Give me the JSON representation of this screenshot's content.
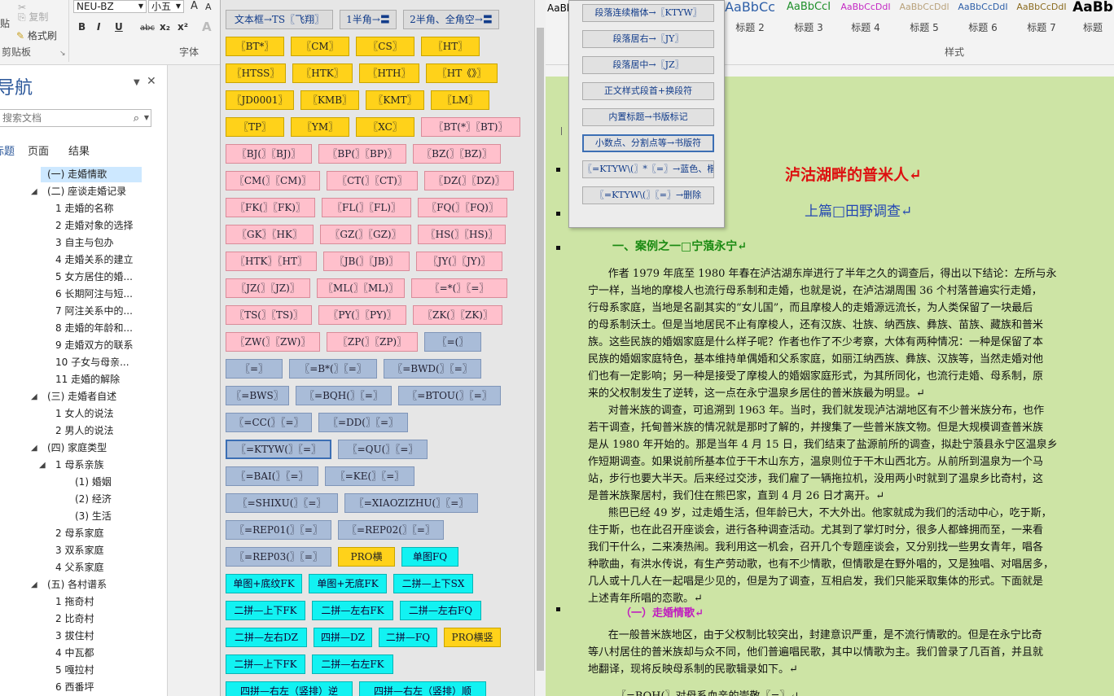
{
  "ribbon": {
    "clipboard": {
      "paste": "贴",
      "copy": "复制",
      "format_painter": "格式刷",
      "label": "剪贴板"
    },
    "font": {
      "name": "NEU-BZ",
      "size": "小五",
      "label": "字体",
      "grow": "A",
      "shrink": "A"
    },
    "font_buttons": [
      "B",
      "I",
      "U",
      "abc",
      "x₂",
      "x²",
      "A"
    ],
    "styles": [
      {
        "sample": "AaBb",
        "name": "",
        "color": "#000000",
        "size": "12px"
      },
      {
        "sample": "AaBbCc",
        "name": "标题 2",
        "color": "#2e5fa8",
        "size": "16px"
      },
      {
        "sample": "AaBbCcI",
        "name": "标题 3",
        "color": "#1f8f2a",
        "size": "13px"
      },
      {
        "sample": "AaBbCcDdI",
        "name": "标题 4",
        "color": "#c42ac4",
        "size": "12px"
      },
      {
        "sample": "AaBbCcDdl",
        "name": "标题 5",
        "color": "#b8a17a",
        "size": "12px"
      },
      {
        "sample": "AaBbCcDdI",
        "name": "标题 6",
        "color": "#2e5fa8",
        "size": "12px"
      },
      {
        "sample": "AaBbCcDdI",
        "name": "标题 7",
        "color": "#8b6b1f",
        "size": "12px"
      },
      {
        "sample": "AaBb",
        "name": "标题",
        "color": "#000000",
        "size": "17px"
      }
    ],
    "styles_label": "样式"
  },
  "nav": {
    "title": "导航",
    "search_placeholder": "搜索文档",
    "tabs": [
      "标题",
      "页面",
      "结果"
    ],
    "items": [
      {
        "text": "(一)  走婚情歌",
        "indent": 58,
        "arrow": "",
        "selected": true
      },
      {
        "text": "(二)  座谈走婚记录",
        "indent": 58,
        "arrow": "◢",
        "selected": false
      },
      {
        "text": "1    走婚的名称",
        "indent": 68,
        "arrow": "",
        "selected": false
      },
      {
        "text": "2    走婚对象的选择",
        "indent": 68,
        "arrow": "",
        "selected": false
      },
      {
        "text": "3    自主与包办",
        "indent": 68,
        "arrow": "",
        "selected": false
      },
      {
        "text": "4    走婚关系的建立",
        "indent": 68,
        "arrow": "",
        "selected": false
      },
      {
        "text": "5    女方居住的婚...",
        "indent": 68,
        "arrow": "",
        "selected": false
      },
      {
        "text": "6    长期阿注与短...",
        "indent": 68,
        "arrow": "",
        "selected": false
      },
      {
        "text": "7    阿注关系中的...",
        "indent": 68,
        "arrow": "",
        "selected": false
      },
      {
        "text": "8    走婚的年龄和...",
        "indent": 68,
        "arrow": "",
        "selected": false
      },
      {
        "text": "9    走婚双方的联系",
        "indent": 68,
        "arrow": "",
        "selected": false
      },
      {
        "text": "10   子女与母亲...",
        "indent": 68,
        "arrow": "",
        "selected": false
      },
      {
        "text": "11   走婚的解除",
        "indent": 68,
        "arrow": "",
        "selected": false
      },
      {
        "text": "(三)  走婚者自述",
        "indent": 58,
        "arrow": "◢",
        "selected": false
      },
      {
        "text": "1    女人的说法",
        "indent": 68,
        "arrow": "",
        "selected": false
      },
      {
        "text": "2    男人的说法",
        "indent": 68,
        "arrow": "",
        "selected": false
      },
      {
        "text": "(四)  家庭类型",
        "indent": 58,
        "arrow": "◢",
        "selected": false
      },
      {
        "text": "1    母系亲族",
        "indent": 68,
        "arrow": "◢",
        "selected": false
      },
      {
        "text": "(1)  婚姻",
        "indent": 92,
        "arrow": "",
        "selected": false
      },
      {
        "text": "(2)  经济",
        "indent": 92,
        "arrow": "",
        "selected": false
      },
      {
        "text": "(3)  生活",
        "indent": 92,
        "arrow": "",
        "selected": false
      },
      {
        "text": "2    母系家庭",
        "indent": 68,
        "arrow": "",
        "selected": false
      },
      {
        "text": "3    双系家庭",
        "indent": 68,
        "arrow": "",
        "selected": false
      },
      {
        "text": "4    父系家庭",
        "indent": 68,
        "arrow": "",
        "selected": false
      },
      {
        "text": "(五)  各村谱系",
        "indent": 58,
        "arrow": "◢",
        "selected": false
      },
      {
        "text": "1    拖奇村",
        "indent": 68,
        "arrow": "",
        "selected": false
      },
      {
        "text": "2    比奇村",
        "indent": 68,
        "arrow": "",
        "selected": false
      },
      {
        "text": "3    拔住村",
        "indent": 68,
        "arrow": "",
        "selected": false
      },
      {
        "text": "4    中瓦都",
        "indent": 68,
        "arrow": "",
        "selected": false
      },
      {
        "text": "5    嘎拉村",
        "indent": 68,
        "arrow": "",
        "selected": false
      },
      {
        "text": "6    西番坪",
        "indent": 68,
        "arrow": "",
        "selected": false
      }
    ]
  },
  "panel": {
    "rows": [
      [
        {
          "label": "文本框→TS〖飞翔〗",
          "color": "gray",
          "w": 132
        },
        {
          "label": "1半角→〓",
          "color": "gray",
          "w": 70
        },
        {
          "label": "2半角、全角空→〓",
          "color": "gray",
          "w": 118
        }
      ],
      [
        {
          "label": "〖BT*〗",
          "color": "yellow",
          "w": 72
        },
        {
          "label": "〖CM〗",
          "color": "yellow",
          "w": 72
        },
        {
          "label": "〖CS〗",
          "color": "yellow",
          "w": 72
        },
        {
          "label": "〖HT〗",
          "color": "yellow",
          "w": 72
        }
      ],
      [
        {
          "label": "〖HTSS〗",
          "color": "yellow",
          "w": 74
        },
        {
          "label": "〖HTK〗",
          "color": "yellow",
          "w": 74
        },
        {
          "label": "〖HTH〗",
          "color": "yellow",
          "w": 74
        },
        {
          "label": "〖HT《》〗",
          "color": "yellow",
          "w": 88
        }
      ],
      [
        {
          "label": "〖JD0001〗",
          "color": "yellow",
          "w": 84
        },
        {
          "label": "〖KMB〗",
          "color": "yellow",
          "w": 72
        },
        {
          "label": "〖KMT〗",
          "color": "yellow",
          "w": 72
        },
        {
          "label": "〖LM〗",
          "color": "yellow",
          "w": 72
        }
      ],
      [
        {
          "label": "〖TP〗",
          "color": "yellow",
          "w": 72
        },
        {
          "label": "〖YM〗",
          "color": "yellow",
          "w": 72
        },
        {
          "label": "〖XC〗",
          "color": "yellow",
          "w": 72
        },
        {
          "label": "〖BT(*〗〖BT)〗",
          "color": "pink",
          "w": 122
        }
      ],
      [
        {
          "label": "〖BJ(〗〖BJ)〗",
          "color": "pink",
          "w": 106
        },
        {
          "label": "〖BP(〗〖BP)〗",
          "color": "pink",
          "w": 108
        },
        {
          "label": "〖BZ(〗〖BZ)〗",
          "color": "pink",
          "w": 108
        }
      ],
      [
        {
          "label": "〖CM(〗〖CM)〗",
          "color": "pink",
          "w": 116
        },
        {
          "label": "〖CT(〗〖CT)〗",
          "color": "pink",
          "w": 112
        },
        {
          "label": "〖DZ(〗〖DZ)〗",
          "color": "pink",
          "w": 110
        }
      ],
      [
        {
          "label": "〖FK(〗〖FK)〗",
          "color": "pink",
          "w": 110
        },
        {
          "label": "〖FL(〗〖FL)〗",
          "color": "pink",
          "w": 110
        },
        {
          "label": "〖FQ(〗〖FQ)〗",
          "color": "pink",
          "w": 110
        }
      ],
      [
        {
          "label": "〖GK〗〖HK〗",
          "color": "pink",
          "w": 108
        },
        {
          "label": "〖GZ(〗〖GZ)〗",
          "color": "pink",
          "w": 112
        },
        {
          "label": "〖HS(〗〖HS)〗",
          "color": "pink",
          "w": 108
        }
      ],
      [
        {
          "label": "〖HTK〗〖HT〗",
          "color": "pink",
          "w": 112
        },
        {
          "label": "〖JB(〗〖JB)〗",
          "color": "pink",
          "w": 106
        },
        {
          "label": "〖JY(〗〖JY)〗",
          "color": "pink",
          "w": 106
        }
      ],
      [
        {
          "label": "〖JZ(〗〖JZ)〗",
          "color": "pink",
          "w": 104
        },
        {
          "label": "〖ML(〗〖ML)〗",
          "color": "pink",
          "w": 108
        },
        {
          "label": "〖=*(〗〖=〗",
          "color": "pink",
          "w": 118
        }
      ],
      [
        {
          "label": "〖TS(〗〖TS)〗",
          "color": "pink",
          "w": 106
        },
        {
          "label": "〖PY(〗〖PY)〗",
          "color": "pink",
          "w": 108
        },
        {
          "label": "〖ZK(〗〖ZK)〗",
          "color": "pink",
          "w": 110
        }
      ],
      [
        {
          "label": "〖ZW(〗〖ZW)〗",
          "color": "pink",
          "w": 116
        },
        {
          "label": "〖ZP(〗〖ZP)〗",
          "color": "pink",
          "w": 112
        },
        {
          "label": "〖=(〗",
          "color": "blue",
          "w": 70
        }
      ],
      [
        {
          "label": "〖=〗",
          "color": "blue",
          "w": 70
        },
        {
          "label": "〖=B*(〗〖=〗",
          "color": "blue",
          "w": 108
        },
        {
          "label": "〖=BWD(〗〖=〗",
          "color": "blue",
          "w": 120
        }
      ],
      [
        {
          "label": "〖=BWS〗",
          "color": "blue",
          "w": 78
        },
        {
          "label": "〖=BQH(〗〖=〗",
          "color": "blue",
          "w": 118
        },
        {
          "label": "〖=BTOU(〗〖=〗",
          "color": "blue",
          "w": 126
        }
      ],
      [
        {
          "label": "〖=CC(〗〖=〗",
          "color": "blue",
          "w": 106
        },
        {
          "label": "〖=DD(〗〖=〗",
          "color": "blue",
          "w": 110
        }
      ],
      [
        {
          "label": "〖=KTYW(〗〖=〗",
          "color": "blue",
          "w": 130,
          "focus": true
        },
        {
          "label": "〖=QU(〗〖=〗",
          "color": "blue",
          "w": 110
        }
      ],
      [
        {
          "label": "〖=BAI(〗〖=〗",
          "color": "blue",
          "w": 114
        },
        {
          "label": "〖=KE(〗〖=〗",
          "color": "blue",
          "w": 110
        }
      ],
      [
        {
          "label": "〖=SHIXU(〗〖=〗",
          "color": "blue",
          "w": 138
        },
        {
          "label": "〖=XIAOZIZHU(〗〖=〗",
          "color": "blue",
          "w": 164
        }
      ],
      [
        {
          "label": "〖=REP01(〗〖=〗",
          "color": "blue",
          "w": 130
        },
        {
          "label": "〖=REP02(〗〖=〗",
          "color": "blue",
          "w": 130
        }
      ],
      [
        {
          "label": "〖=REP03(〗〖=〗",
          "color": "blue",
          "w": 130
        },
        {
          "label": "PRO横",
          "color": "yellow",
          "w": 70
        },
        {
          "label": "单图FQ",
          "color": "cyan",
          "w": 70
        }
      ],
      [
        {
          "label": "单图+底纹FK",
          "color": "cyan",
          "w": 94
        },
        {
          "label": "单图+无底FK",
          "color": "cyan",
          "w": 96
        },
        {
          "label": "二拼—上下SX",
          "color": "cyan",
          "w": 98
        }
      ],
      [
        {
          "label": "二拼—上下FK",
          "color": "cyan",
          "w": 98
        },
        {
          "label": "二拼—左右FK",
          "color": "cyan",
          "w": 100
        },
        {
          "label": "二拼—左右FQ",
          "color": "cyan",
          "w": 100
        }
      ],
      [
        {
          "label": "二拼—左右DZ",
          "color": "cyan",
          "w": 100
        },
        {
          "label": "四拼—DZ",
          "color": "cyan",
          "w": 72
        },
        {
          "label": "二拼—FQ",
          "color": "cyan",
          "w": 72
        },
        {
          "label": "PRO横竖",
          "color": "yellow",
          "w": 70
        }
      ],
      [
        {
          "label": "二拼—上下FK",
          "color": "cyan",
          "w": 98
        },
        {
          "label": "二拼—右左FK",
          "color": "cyan",
          "w": 100
        }
      ],
      [
        {
          "label": "四拼—右左（竖排）逆",
          "color": "cyan",
          "w": 156
        },
        {
          "label": "四拼—右左（竖排）顺",
          "color": "cyan",
          "w": 156
        }
      ]
    ]
  },
  "popup": {
    "items": [
      {
        "label": "段落连续楷体→〖KTYW〗",
        "focus": false
      },
      {
        "label": "段落居右→〖JY〗",
        "focus": false
      },
      {
        "label": "段落居中→〖JZ〗",
        "focus": false
      },
      {
        "label": "正文样式段首+换段符",
        "focus": false
      },
      {
        "label": "内置标题→书版标记",
        "focus": false
      },
      {
        "label": "小数点、分割点等→书版符",
        "focus": true
      },
      {
        "label": "〖=KTYW\\(〗*〖=〗→蓝色、楷体",
        "focus": false
      },
      {
        "label": "〖=KTYW\\(〗〖=〗→删除",
        "focus": false
      }
    ]
  },
  "doc": {
    "title": "泸沽湖畔的普米人↵",
    "subtitle": "上篇□田野调查↵",
    "h1": "一、案例之一□宁蒗永宁↵",
    "para1": [
      "      作者 1979 年底至 1980 年春在泸沽湖东岸进行了半年之久的调查后，得出以下结论：左所与永",
      "宁一样，当地的摩梭人也流行母系制和走婚，也就是说，在泸沽湖周围 36 个村落普遍实行走婚，",
      "行母系家庭，当地是名副其实的“女儿国”，而且摩梭人的走婚源远流长，为人类保留了一块最后",
      "的母系制沃土。但是当地居民不止有摩梭人，还有汉族、壮族、纳西族、彝族、苗族、藏族和普米",
      "族。这些民族的婚姻家庭是什么样子呢？作者也作了不少考察，大体有两种情况：一种是保留了本",
      "民族的婚姻家庭特色，基本维持单偶婚和父系家庭，如丽江纳西族、彝族、汉族等，当然走婚对他",
      "们也有一定影响；另一种是接受了摩梭人的婚姻家庭形式，为其所同化，也流行走婚、母系制，原",
      "来的父权制发生了逆转，这一点在永宁温泉乡居住的普米族最为明显。↵"
    ],
    "para2": [
      "      对普米族的调查，可追溯到 1963 年。当时，我们就发现泸沽湖地区有不少普米族分布，也作",
      "若干调查，托甸普米族的情况就是那时了解的，并搜集了一些普米族文物。但是大规模调查普米族",
      "是从 1980 年开始的。那是当年 4 月 15 日，我们结束了盐源前所的调查，拟赴宁蒗县永宁区温泉乡",
      "作短期调查。如果说前所基本位于干木山东方，温泉则位于干木山西北方。从前所到温泉为一个马",
      "站，步行也要大半天。后来经过交涉，我们雇了一辆拖拉机，没用两小时就到了温泉乡比奇村，这",
      "是普米族聚居村，我们住在熊巴家，直到 4 月 26 日才离开。↵"
    ],
    "para3": [
      "      熊巴已经 49 岁，过走婚生活，但年龄已大，不大外出。他家就成为我们的活动中心，吃于斯，",
      "住于斯，也在此召开座谈会，进行各种调查活动。尤其到了掌灯时分，很多人都蜂拥而至，一来看",
      "我们干什么，二来凑热闹。我利用这一机会，召开几个专题座谈会，又分别找一些男女青年，唱各",
      "种歌曲，有洪水传说，有生产劳动歌，也有不少情歌，但情歌是在野外唱的，又是独唱、对唱居多，",
      "几人或十几人在一起唱是少见的，但是为了调查，互相启发，我们只能采取集体的形式。下面就是",
      "上述青年所唱的恋歌。↵"
    ],
    "h2": "（一）走婚情歌↵",
    "para4": [
      "      在一般普米族地区，由于父权制比较突出，封建意识严重，是不流行情歌的。但是在永宁比奇",
      "等八村居住的普米族却与众不同，他们普遍唱民歌，其中以情歌为主。我们曾录了几百首，并且就",
      "地翻译，现将反映母系制的民歌辑录如下。↵"
    ],
    "last": "〖=BQH(〗对母系血亲的崇敬〖=〗↵"
  }
}
